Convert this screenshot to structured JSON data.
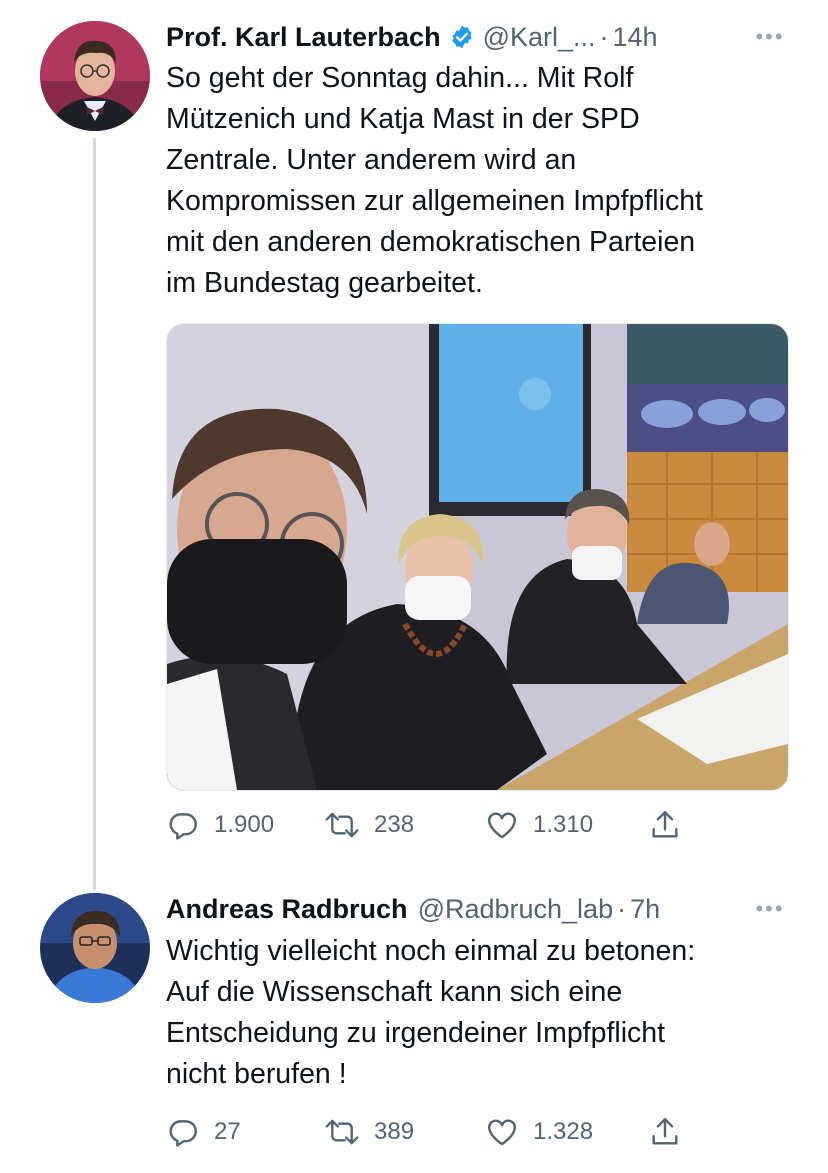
{
  "tweets": [
    {
      "author": "Prof. Karl Lauterbach",
      "handle": "@Karl_...",
      "separator": "·",
      "time": "14h",
      "verified": true,
      "text": "So geht der Sonntag dahin... Mit Rolf\nMützenich und Katja Mast in der SPD\nZentrale. Unter anderem wird an\nKompromissen zur allgemeinen Impfpflicht\nmit den anderen demokratischen Parteien\nim Bundestag gearbeitet.",
      "replies": "1.900",
      "retweets": "238",
      "likes": "1.310"
    },
    {
      "author": "Andreas Radbruch",
      "handle": "@Radbruch_lab",
      "separator": "·",
      "time": "7h",
      "verified": false,
      "text": "Wichtig vielleicht noch einmal zu betonen:\nAuf die Wissenschaft kann sich eine\nEntscheidung zu irgendeiner Impfpflicht\nnicht berufen !",
      "replies": "27",
      "retweets": "389",
      "likes": "1.328"
    }
  ],
  "more_glyph": "•••",
  "colors": {
    "text": "#0f1419",
    "secondary": "#536471",
    "verified": "#1d9bf0",
    "thread_line": "#cfd9de"
  },
  "icons": [
    "reply-icon",
    "retweet-icon",
    "like-icon",
    "share-icon",
    "verified-badge-icon",
    "more-icon"
  ]
}
